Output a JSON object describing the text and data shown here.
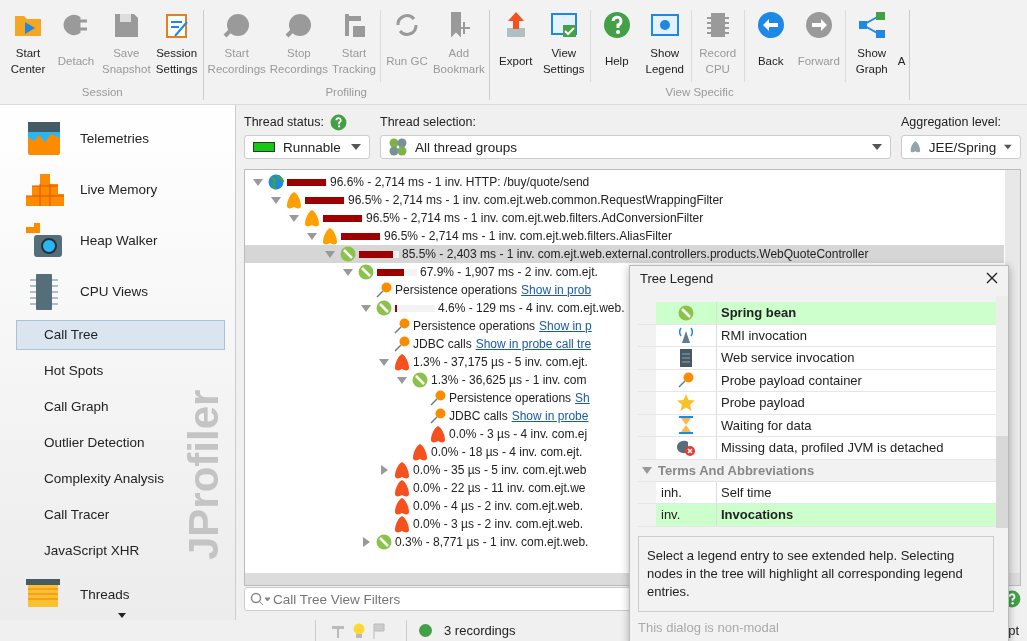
{
  "toolbar": {
    "groups": [
      {
        "label": "Session",
        "sections": [
          [
            {
              "label": "Start\nCenter",
              "disabled": false
            },
            {
              "label": "Detach",
              "disabled": true
            },
            {
              "label": "Save\nSnapshot",
              "disabled": true
            },
            {
              "label": "Session\nSettings",
              "disabled": false
            }
          ]
        ]
      },
      {
        "label": "Profiling",
        "sections": [
          [
            {
              "label": "Start\nRecordings",
              "disabled": true
            },
            {
              "label": "Stop\nRecordings",
              "disabled": true
            },
            {
              "label": "Start\nTracking",
              "disabled": true
            }
          ],
          [
            {
              "label": "Run GC",
              "disabled": true
            },
            {
              "label": "Add\nBookmark",
              "disabled": true
            }
          ]
        ]
      },
      {
        "label": "View Specific",
        "sections": [
          [
            {
              "label": "Export",
              "disabled": false
            },
            {
              "label": "View\nSettings",
              "disabled": false
            }
          ],
          [
            {
              "label": "Help",
              "disabled": false
            },
            {
              "label": "Show\nLegend",
              "disabled": false
            }
          ],
          [
            {
              "label": "Record\nCPU",
              "disabled": true
            }
          ],
          [
            {
              "label": "Back",
              "disabled": false
            },
            {
              "label": "Forward",
              "disabled": true
            }
          ],
          [
            {
              "label": "Show\nGraph",
              "disabled": false
            },
            {
              "label": "A",
              "disabled": false
            }
          ]
        ]
      }
    ]
  },
  "sidebar": {
    "items": [
      {
        "label": "Telemetries",
        "kind": "section",
        "selected": false
      },
      {
        "label": "Live Memory",
        "kind": "section",
        "selected": false
      },
      {
        "label": "Heap Walker",
        "kind": "section",
        "selected": false
      },
      {
        "label": "CPU Views",
        "kind": "section",
        "selected": false
      },
      {
        "label": "Call Tree",
        "kind": "view",
        "selected": true
      },
      {
        "label": "Hot Spots",
        "kind": "view",
        "selected": false
      },
      {
        "label": "Call Graph",
        "kind": "view",
        "selected": false
      },
      {
        "label": "Outlier Detection",
        "kind": "view",
        "selected": false
      },
      {
        "label": "Complexity Analysis",
        "kind": "view",
        "selected": false
      },
      {
        "label": "Call Tracer",
        "kind": "view",
        "selected": false
      },
      {
        "label": "JavaScript XHR",
        "kind": "view",
        "selected": false
      },
      {
        "label": "Threads",
        "kind": "section",
        "selected": false
      }
    ],
    "brand": "JProfiler"
  },
  "filters": {
    "thread_status": {
      "label": "Thread status:",
      "value": "Runnable"
    },
    "thread_selection": {
      "label": "Thread selection:",
      "value": "All thread groups"
    },
    "aggregation_level": {
      "label": "Aggregation level:",
      "value": "JEE/Spring"
    }
  },
  "call_tree": {
    "nodes": [
      {
        "kind": "url",
        "expanded": true,
        "selected": false,
        "level": 0.966,
        "text": "96.6% - 2,714 ms - 1 inv. HTTP: /buy/quote/send",
        "children": [
          {
            "kind": "filter",
            "expanded": true,
            "selected": false,
            "level": 0.965,
            "text": "96.5% - 2,714 ms - 1 inv. com.ejt.web.common.RequestWrappingFilter",
            "children": [
              {
                "kind": "filter",
                "expanded": true,
                "selected": false,
                "level": 0.965,
                "text": "96.5% - 2,714 ms - 1 inv. com.ejt.web.filters.AdConversionFilter",
                "children": [
                  {
                    "kind": "filter",
                    "expanded": true,
                    "selected": false,
                    "level": 0.965,
                    "text": "96.5% - 2,714 ms - 1 inv. com.ejt.web.filters.AliasFilter",
                    "children": [
                      {
                        "kind": "spring",
                        "expanded": true,
                        "selected": true,
                        "level": 0.855,
                        "text": "85.5% - 2,403 ms - 1 inv. com.ejt.web.external.controllers.products.WebQuoteController",
                        "children": [
                          {
                            "kind": "spring",
                            "expanded": true,
                            "selected": false,
                            "level": 0.679,
                            "text": "67.9% - 1,907 ms - 2 inv. com.ejt.",
                            "children": [
                              {
                                "kind": "probe",
                                "selected": false,
                                "text": "Persistence operations",
                                "link": "Show in prob"
                              },
                              {
                                "kind": "spring",
                                "expanded": true,
                                "selected": false,
                                "level": 0.046,
                                "text": "4.6% - 129 ms - 4 inv. com.ejt.web.",
                                "children": [
                                  {
                                    "kind": "probe",
                                    "selected": false,
                                    "text": "Persistence operations",
                                    "link": "Show in p"
                                  },
                                  {
                                    "kind": "probe",
                                    "selected": false,
                                    "text": "JDBC calls",
                                    "link": "Show in probe call tre"
                                  },
                                  {
                                    "kind": "ejb",
                                    "expanded": true,
                                    "selected": false,
                                    "text": "1.3% - 37,175 µs - 5 inv. com.ejt.",
                                    "children": [
                                      {
                                        "kind": "spring",
                                        "expanded": true,
                                        "selected": false,
                                        "text": "1.3% - 36,625 µs - 1 inv. com",
                                        "children": [
                                          {
                                            "kind": "probe",
                                            "selected": false,
                                            "text": "Persistence operations",
                                            "link": "Sh"
                                          },
                                          {
                                            "kind": "probe",
                                            "selected": false,
                                            "text": "JDBC calls",
                                            "link": "Show in probe"
                                          },
                                          {
                                            "kind": "ejb",
                                            "selected": false,
                                            "text": "0.0% - 3 µs - 4 inv. com.ej"
                                          }
                                        ]
                                      },
                                      {
                                        "kind": "ejb",
                                        "selected": false,
                                        "text": "0.0% - 18 µs - 4 inv. com.ejt."
                                      }
                                    ]
                                  },
                                  {
                                    "kind": "ejb",
                                    "expanded": false,
                                    "selected": false,
                                    "text": "0.0% - 35 µs - 5 inv. com.ejt.web"
                                  },
                                  {
                                    "kind": "ejb",
                                    "selected": false,
                                    "text": "0.0% - 22 µs - 11 inv. com.ejt.we"
                                  },
                                  {
                                    "kind": "ejb",
                                    "selected": false,
                                    "text": "0.0% - 4 µs - 2 inv. com.ejt.web."
                                  },
                                  {
                                    "kind": "ejb",
                                    "selected": false,
                                    "text": "0.0% - 3 µs - 2 inv. com.ejt.web."
                                  }
                                ]
                              },
                              {
                                "kind": "spring",
                                "expanded": false,
                                "selected": false,
                                "text": "0.3% - 8,771 µs - 1 inv. com.ejt.web."
                              }
                            ]
                          }
                        ]
                      }
                    ]
                  }
                ]
              }
            ]
          }
        ]
      }
    ]
  },
  "view_filter": {
    "placeholder": "Call Tree View Filters"
  },
  "status_bar": {
    "recordings": "3 recordings",
    "column_3": "pt"
  },
  "legend_dialog": {
    "title": "Tree Legend",
    "entries": [
      {
        "kind": "spring",
        "label": "Spring bean",
        "selected": true
      },
      {
        "kind": "rmi",
        "label": "RMI invocation",
        "selected": false
      },
      {
        "kind": "webservice",
        "label": "Web service invocation",
        "selected": false
      },
      {
        "kind": "probe",
        "label": "Probe payload container",
        "selected": false
      },
      {
        "kind": "payload",
        "label": "Probe payload",
        "selected": false
      },
      {
        "kind": "waiting",
        "label": "Waiting for data",
        "selected": false
      },
      {
        "kind": "detached",
        "label": "Missing data, profiled JVM is detached",
        "selected": false
      }
    ],
    "terms_section": {
      "title": "Terms And Abbreviations",
      "expanded": true,
      "terms": [
        {
          "term": "inh.",
          "meaning": "Self time",
          "selected": false
        },
        {
          "term": "inv.",
          "meaning": "Invocations",
          "selected": true
        }
      ]
    },
    "help_text": "Select a legend entry to see extended help. Selecting nodes in the tree will highlight all corresponding legend entries.",
    "footer": "This dialog is non-modal"
  }
}
